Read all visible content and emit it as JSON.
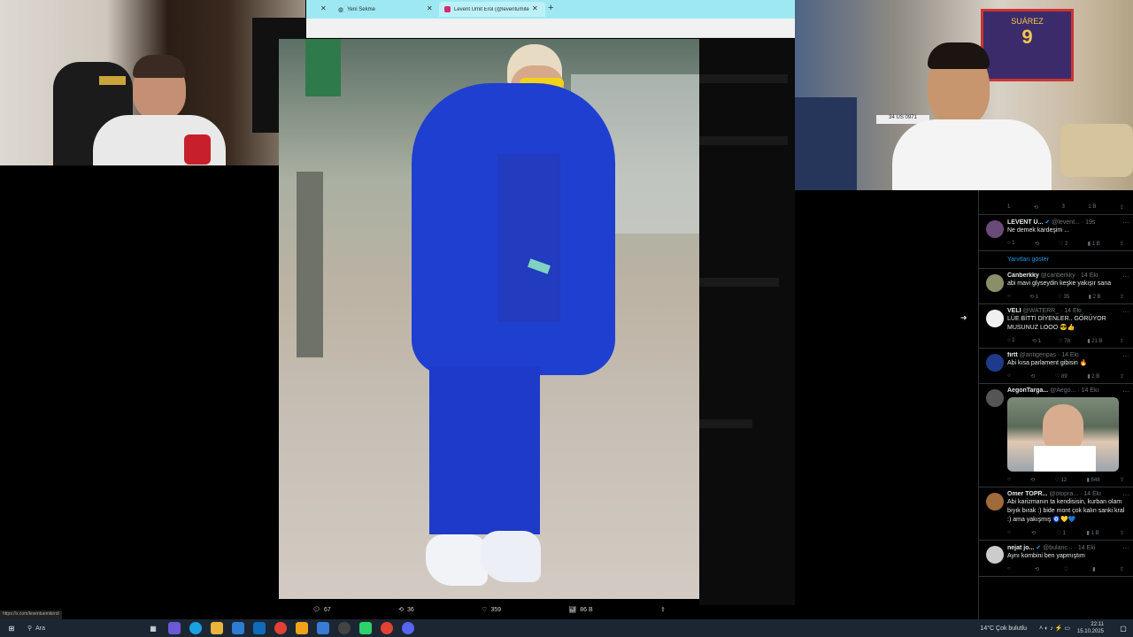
{
  "browser": {
    "tabs": [
      {
        "label": "Yeni Sekme",
        "icon": "globe-icon"
      },
      {
        "label": "Levent Ümit Erol (@leventumite",
        "icon": "instagram-icon"
      }
    ],
    "new_tab_icon": "plus-icon"
  },
  "viewer": {
    "image_alt": "Man in blue puffer jacket and blue tracksuit",
    "actions": [
      {
        "icon": "reply-icon",
        "count": "67"
      },
      {
        "icon": "retweet-icon",
        "count": "36"
      },
      {
        "icon": "like-icon",
        "count": "359"
      },
      {
        "icon": "views-icon",
        "count": "86 B"
      },
      {
        "icon": "share-icon",
        "count": ""
      }
    ],
    "next_icon": "arrow-right-icon",
    "status_link": "https://x.com/leventuemiterol"
  },
  "replies": {
    "top_stats": {
      "reply": "1",
      "rt": "",
      "like": "3",
      "views": "1 B"
    },
    "items": [
      {
        "name": "LEVENT Ü...",
        "verified": true,
        "handle": "@levent... · 19s",
        "text": "Ne demek kardeşim ...",
        "reply": "1",
        "rt": "",
        "like": "2",
        "views": "1 B",
        "avatar": "#6b4a7a"
      },
      {
        "name": "Canberkky",
        "verified": false,
        "handle": "@canberkky · 14 Eki",
        "text": "abi mavi glyseydin keşke yakışır sana",
        "reply": "",
        "rt": "1",
        "like": "35",
        "views": "2 B",
        "avatar": "#8a8f6a"
      },
      {
        "name": "VELİ",
        "verified": false,
        "handle": "@WATERR_ · 14 Eki",
        "text": "LÜE BİTTİ DİYENLER.. GÖRÜYOR MUSUNUZ LOOO 😎👍",
        "reply": "1",
        "rt": "1",
        "like": "78",
        "views": "21 B",
        "avatar": "#f0f0f0"
      },
      {
        "name": "firtt",
        "verified": false,
        "handle": "@antigeripas · 14 Eki",
        "text": "Abi kısa parlament gibisin 🔥",
        "reply": "",
        "rt": "",
        "like": "89",
        "views": "2 B",
        "avatar": "#1e3a8a"
      },
      {
        "name": "AegonTarga...",
        "verified": false,
        "handle": "@Aego... · 14 Eki",
        "text": "",
        "reply": "",
        "rt": "",
        "like": "12",
        "views": "848",
        "avatar": "#555",
        "has_image": true
      },
      {
        "name": "Ömer TOPR...",
        "verified": false,
        "handle": "@otopra... · 14 Eki",
        "text": "Abi karizmanın ta kendisisin, kurban olam bıyık bırak :) bide mont çok kalın sanki kral :) ama yakışmış 🧿💛💙",
        "reply": "",
        "rt": "",
        "like": "1",
        "views": "1 B",
        "avatar": "#a06a3a"
      },
      {
        "name": "nejat jo...",
        "verified": true,
        "handle": "@bulanc... · 14 Eki",
        "text": "Aynı kombini ben yapmıştım",
        "reply": "",
        "rt": "",
        "like": "",
        "views": "",
        "avatar": "#ccc"
      }
    ],
    "show_replies": "Yanıtları göster"
  },
  "taskbar": {
    "search_placeholder": "Ara",
    "weather": "14°C  Çok bulutlu",
    "time": "22:11",
    "date": "15.10.2025"
  },
  "colors": {
    "tab_bar": "#9ee8f3",
    "jacket": "#1f3fd0",
    "taskbar": "#1c2633",
    "link": "#1d9bf0"
  }
}
